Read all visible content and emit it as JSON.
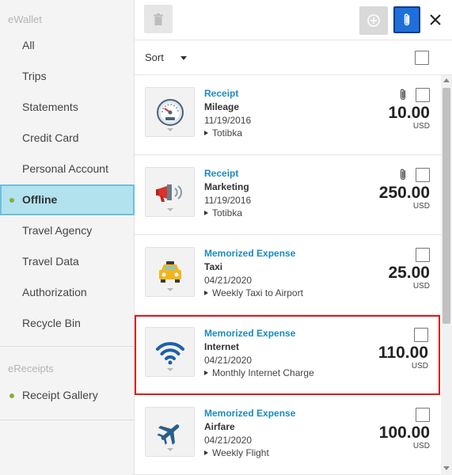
{
  "sidebar": {
    "ewallet_title": "eWallet",
    "items": [
      {
        "label": "All"
      },
      {
        "label": "Trips"
      },
      {
        "label": "Statements"
      },
      {
        "label": "Credit Card"
      },
      {
        "label": "Personal Account"
      },
      {
        "label": "Offline",
        "active": true
      },
      {
        "label": "Travel Agency"
      },
      {
        "label": "Travel Data"
      },
      {
        "label": "Authorization"
      },
      {
        "label": "Recycle Bin"
      }
    ],
    "ereceipts_title": "eReceipts",
    "ereceipts_items": [
      {
        "label": "Receipt Gallery"
      }
    ],
    "dot_color": "#7fb23b"
  },
  "toolbar": {
    "delete_icon": "trash-icon",
    "add_icon": "plus-circle-icon",
    "attach_icon": "paperclip-icon",
    "close_icon": "close-icon",
    "attach_color": "#1e6fd9"
  },
  "sort": {
    "label": "Sort"
  },
  "expenses": [
    {
      "type": "Receipt",
      "name": "Mileage",
      "date": "11/19/2016",
      "description": "Totibka",
      "amount": "10.00",
      "currency": "USD",
      "icon": "speedometer-icon",
      "attachment": true,
      "highlighted": false
    },
    {
      "type": "Receipt",
      "name": "Marketing",
      "date": "11/19/2016",
      "description": "Totibka",
      "amount": "250.00",
      "currency": "USD",
      "icon": "megaphone-icon",
      "attachment": true,
      "highlighted": false
    },
    {
      "type": "Memorized Expense",
      "name": "Taxi",
      "date": "04/21/2020",
      "description": "Weekly Taxi to Airport",
      "amount": "25.00",
      "currency": "USD",
      "icon": "taxi-icon",
      "attachment": false,
      "highlighted": false
    },
    {
      "type": "Memorized Expense",
      "name": "Internet",
      "date": "04/21/2020",
      "description": "Monthly Internet Charge",
      "amount": "110.00",
      "currency": "USD",
      "icon": "wifi-icon",
      "attachment": false,
      "highlighted": true
    },
    {
      "type": "Memorized Expense",
      "name": "Airfare",
      "date": "04/21/2020",
      "description": "Weekly Flight",
      "amount": "100.00",
      "currency": "USD",
      "icon": "airplane-icon",
      "attachment": false,
      "highlighted": false
    }
  ],
  "colors": {
    "link_blue": "#1a8ac5",
    "active_bg": "#b3e2ef",
    "highlight_border": "#e01b1b"
  }
}
